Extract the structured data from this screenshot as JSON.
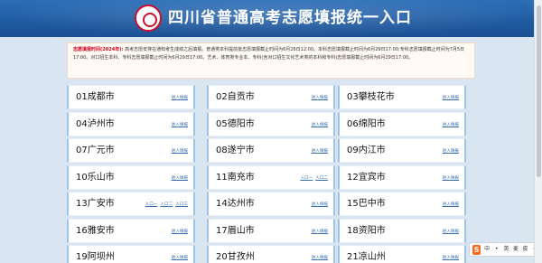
{
  "header": {
    "title": "四川省普通高考志愿填报统一入口",
    "background_color": "#2063ac",
    "emblem_icon": "sichuan-exam-emblem"
  },
  "notice": {
    "lead": "志愿填报时间(2024年):",
    "body": "高考志愿安排在通知考生成绩之后填报。普通类本科提前批志愿填报截止时间为6月26日12:00。本科志愿填报截止时间为6月29日17:00;专科志愿填报截止时间为7月5日17:00。对口招生本科、专科志愿填报截止时间为6月29日17:00。艺术、体育类专业本、专科(含对口招生文化艺术类的本科和专科)志愿填报截止时间为6月29日17:00。"
  },
  "cities": [
    {
      "name": "01成都市",
      "links": [
        "进入填报"
      ]
    },
    {
      "name": "02自贡市",
      "links": [
        "进入填报"
      ]
    },
    {
      "name": "03攀枝花市",
      "links": [
        "进入填报"
      ]
    },
    {
      "name": "04泸州市",
      "links": [
        "进入填报"
      ]
    },
    {
      "name": "05德阳市",
      "links": [
        "进入填报"
      ]
    },
    {
      "name": "06绵阳市",
      "links": [
        "进入填报"
      ]
    },
    {
      "name": "07广元市",
      "links": [
        "进入填报"
      ]
    },
    {
      "name": "08遂宁市",
      "links": [
        "进入填报"
      ]
    },
    {
      "name": "09内江市",
      "links": [
        "进入填报"
      ]
    },
    {
      "name": "10乐山市",
      "links": [
        "进入填报"
      ]
    },
    {
      "name": "11南充市",
      "links": [
        "入口一",
        "入口二"
      ]
    },
    {
      "name": "12宜宾市",
      "links": [
        "进入填报"
      ]
    },
    {
      "name": "13广安市",
      "links": [
        "入口一",
        "入口二",
        "入口三"
      ]
    },
    {
      "name": "14达州市",
      "links": [
        "进入填报"
      ]
    },
    {
      "name": "15巴中市",
      "links": [
        "进入填报"
      ]
    },
    {
      "name": "16雅安市",
      "links": [
        "进入填报"
      ]
    },
    {
      "name": "17眉山市",
      "links": [
        "进入填报"
      ]
    },
    {
      "name": "18资阳市",
      "links": [
        "进入填报"
      ]
    },
    {
      "name": "19阿坝州",
      "links": [
        "进入填报"
      ]
    },
    {
      "name": "20甘孜州",
      "links": [
        "进入填报"
      ]
    },
    {
      "name": "21凉山州",
      "links": [
        "进入填报"
      ]
    }
  ],
  "input_widget": {
    "logo": "S",
    "items": [
      "中",
      "•",
      "英",
      "麦",
      "皮",
      "⋯"
    ]
  }
}
